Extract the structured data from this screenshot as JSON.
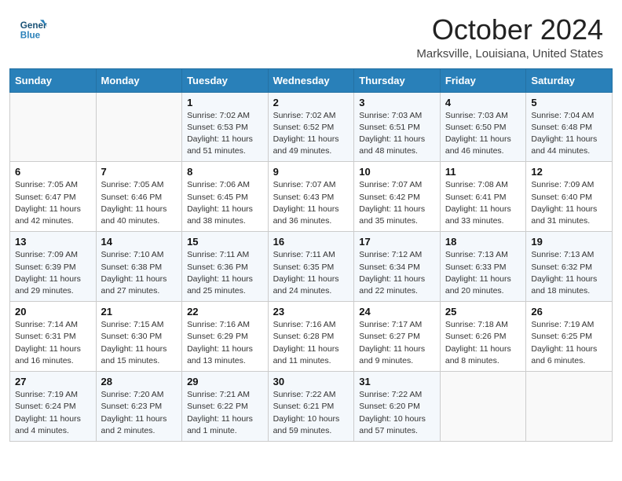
{
  "header": {
    "logo_line1": "General",
    "logo_line2": "Blue",
    "month": "October 2024",
    "location": "Marksville, Louisiana, United States"
  },
  "weekdays": [
    "Sunday",
    "Monday",
    "Tuesday",
    "Wednesday",
    "Thursday",
    "Friday",
    "Saturday"
  ],
  "weeks": [
    [
      {
        "day": "",
        "info": ""
      },
      {
        "day": "",
        "info": ""
      },
      {
        "day": "1",
        "info": "Sunrise: 7:02 AM\nSunset: 6:53 PM\nDaylight: 11 hours and 51 minutes."
      },
      {
        "day": "2",
        "info": "Sunrise: 7:02 AM\nSunset: 6:52 PM\nDaylight: 11 hours and 49 minutes."
      },
      {
        "day": "3",
        "info": "Sunrise: 7:03 AM\nSunset: 6:51 PM\nDaylight: 11 hours and 48 minutes."
      },
      {
        "day": "4",
        "info": "Sunrise: 7:03 AM\nSunset: 6:50 PM\nDaylight: 11 hours and 46 minutes."
      },
      {
        "day": "5",
        "info": "Sunrise: 7:04 AM\nSunset: 6:48 PM\nDaylight: 11 hours and 44 minutes."
      }
    ],
    [
      {
        "day": "6",
        "info": "Sunrise: 7:05 AM\nSunset: 6:47 PM\nDaylight: 11 hours and 42 minutes."
      },
      {
        "day": "7",
        "info": "Sunrise: 7:05 AM\nSunset: 6:46 PM\nDaylight: 11 hours and 40 minutes."
      },
      {
        "day": "8",
        "info": "Sunrise: 7:06 AM\nSunset: 6:45 PM\nDaylight: 11 hours and 38 minutes."
      },
      {
        "day": "9",
        "info": "Sunrise: 7:07 AM\nSunset: 6:43 PM\nDaylight: 11 hours and 36 minutes."
      },
      {
        "day": "10",
        "info": "Sunrise: 7:07 AM\nSunset: 6:42 PM\nDaylight: 11 hours and 35 minutes."
      },
      {
        "day": "11",
        "info": "Sunrise: 7:08 AM\nSunset: 6:41 PM\nDaylight: 11 hours and 33 minutes."
      },
      {
        "day": "12",
        "info": "Sunrise: 7:09 AM\nSunset: 6:40 PM\nDaylight: 11 hours and 31 minutes."
      }
    ],
    [
      {
        "day": "13",
        "info": "Sunrise: 7:09 AM\nSunset: 6:39 PM\nDaylight: 11 hours and 29 minutes."
      },
      {
        "day": "14",
        "info": "Sunrise: 7:10 AM\nSunset: 6:38 PM\nDaylight: 11 hours and 27 minutes."
      },
      {
        "day": "15",
        "info": "Sunrise: 7:11 AM\nSunset: 6:36 PM\nDaylight: 11 hours and 25 minutes."
      },
      {
        "day": "16",
        "info": "Sunrise: 7:11 AM\nSunset: 6:35 PM\nDaylight: 11 hours and 24 minutes."
      },
      {
        "day": "17",
        "info": "Sunrise: 7:12 AM\nSunset: 6:34 PM\nDaylight: 11 hours and 22 minutes."
      },
      {
        "day": "18",
        "info": "Sunrise: 7:13 AM\nSunset: 6:33 PM\nDaylight: 11 hours and 20 minutes."
      },
      {
        "day": "19",
        "info": "Sunrise: 7:13 AM\nSunset: 6:32 PM\nDaylight: 11 hours and 18 minutes."
      }
    ],
    [
      {
        "day": "20",
        "info": "Sunrise: 7:14 AM\nSunset: 6:31 PM\nDaylight: 11 hours and 16 minutes."
      },
      {
        "day": "21",
        "info": "Sunrise: 7:15 AM\nSunset: 6:30 PM\nDaylight: 11 hours and 15 minutes."
      },
      {
        "day": "22",
        "info": "Sunrise: 7:16 AM\nSunset: 6:29 PM\nDaylight: 11 hours and 13 minutes."
      },
      {
        "day": "23",
        "info": "Sunrise: 7:16 AM\nSunset: 6:28 PM\nDaylight: 11 hours and 11 minutes."
      },
      {
        "day": "24",
        "info": "Sunrise: 7:17 AM\nSunset: 6:27 PM\nDaylight: 11 hours and 9 minutes."
      },
      {
        "day": "25",
        "info": "Sunrise: 7:18 AM\nSunset: 6:26 PM\nDaylight: 11 hours and 8 minutes."
      },
      {
        "day": "26",
        "info": "Sunrise: 7:19 AM\nSunset: 6:25 PM\nDaylight: 11 hours and 6 minutes."
      }
    ],
    [
      {
        "day": "27",
        "info": "Sunrise: 7:19 AM\nSunset: 6:24 PM\nDaylight: 11 hours and 4 minutes."
      },
      {
        "day": "28",
        "info": "Sunrise: 7:20 AM\nSunset: 6:23 PM\nDaylight: 11 hours and 2 minutes."
      },
      {
        "day": "29",
        "info": "Sunrise: 7:21 AM\nSunset: 6:22 PM\nDaylight: 11 hours and 1 minute."
      },
      {
        "day": "30",
        "info": "Sunrise: 7:22 AM\nSunset: 6:21 PM\nDaylight: 10 hours and 59 minutes."
      },
      {
        "day": "31",
        "info": "Sunrise: 7:22 AM\nSunset: 6:20 PM\nDaylight: 10 hours and 57 minutes."
      },
      {
        "day": "",
        "info": ""
      },
      {
        "day": "",
        "info": ""
      }
    ]
  ]
}
